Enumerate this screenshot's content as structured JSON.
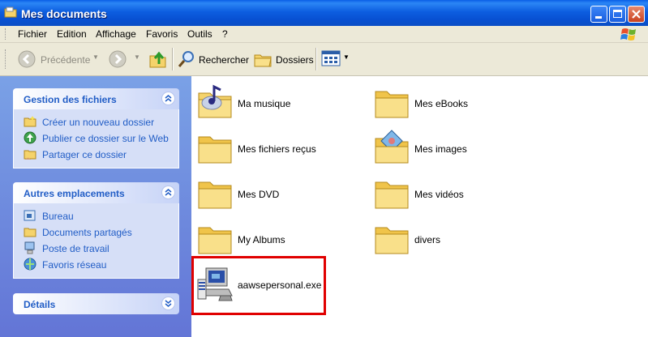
{
  "window": {
    "title": "Mes documents"
  },
  "menu": [
    "Fichier",
    "Edition",
    "Affichage",
    "Favoris",
    "Outils",
    "?"
  ],
  "toolbar": {
    "back": "Précédente",
    "search": "Rechercher",
    "folders": "Dossiers"
  },
  "panels": {
    "file_tasks": {
      "title": "Gestion des fichiers",
      "items": [
        "Créer un nouveau dossier",
        "Publier ce dossier sur le Web",
        "Partager ce dossier"
      ]
    },
    "other_places": {
      "title": "Autres emplacements",
      "items": [
        "Bureau",
        "Documents partagés",
        "Poste de travail",
        "Favoris réseau"
      ]
    },
    "details": {
      "title": "Détails"
    }
  },
  "files": [
    {
      "name": "Ma musique",
      "icon": "music-folder-icon"
    },
    {
      "name": "Mes eBooks",
      "icon": "folder-icon"
    },
    {
      "name": "Mes fichiers reçus",
      "icon": "folder-icon"
    },
    {
      "name": "Mes images",
      "icon": "pictures-folder-icon"
    },
    {
      "name": "Mes DVD",
      "icon": "folder-icon"
    },
    {
      "name": "Mes vidéos",
      "icon": "folder-icon"
    },
    {
      "name": "My Albums",
      "icon": "folder-icon"
    },
    {
      "name": "divers",
      "icon": "folder-icon"
    },
    {
      "name": "aawsepersonal.exe",
      "icon": "installer-exe-icon"
    }
  ],
  "colors": {
    "title_bar": "#0a5fe6",
    "sidebar": "#7aa1e6",
    "link": "#215dc6",
    "highlight": "#e00000"
  }
}
